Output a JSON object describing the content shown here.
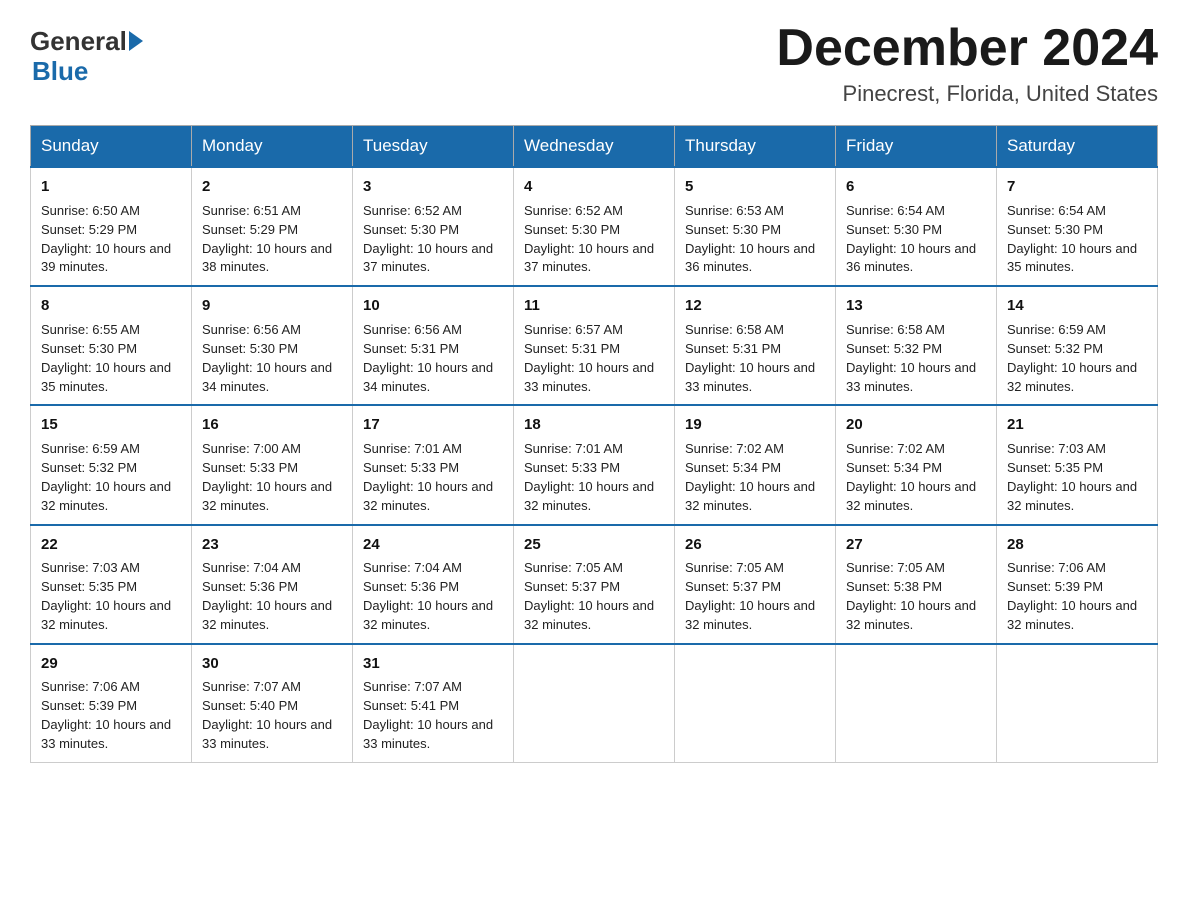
{
  "header": {
    "logo_general": "General",
    "logo_blue": "Blue",
    "month_title": "December 2024",
    "location": "Pinecrest, Florida, United States"
  },
  "weekdays": [
    "Sunday",
    "Monday",
    "Tuesday",
    "Wednesday",
    "Thursday",
    "Friday",
    "Saturday"
  ],
  "weeks": [
    [
      {
        "day": "1",
        "sunrise": "6:50 AM",
        "sunset": "5:29 PM",
        "daylight": "10 hours and 39 minutes."
      },
      {
        "day": "2",
        "sunrise": "6:51 AM",
        "sunset": "5:29 PM",
        "daylight": "10 hours and 38 minutes."
      },
      {
        "day": "3",
        "sunrise": "6:52 AM",
        "sunset": "5:30 PM",
        "daylight": "10 hours and 37 minutes."
      },
      {
        "day": "4",
        "sunrise": "6:52 AM",
        "sunset": "5:30 PM",
        "daylight": "10 hours and 37 minutes."
      },
      {
        "day": "5",
        "sunrise": "6:53 AM",
        "sunset": "5:30 PM",
        "daylight": "10 hours and 36 minutes."
      },
      {
        "day": "6",
        "sunrise": "6:54 AM",
        "sunset": "5:30 PM",
        "daylight": "10 hours and 36 minutes."
      },
      {
        "day": "7",
        "sunrise": "6:54 AM",
        "sunset": "5:30 PM",
        "daylight": "10 hours and 35 minutes."
      }
    ],
    [
      {
        "day": "8",
        "sunrise": "6:55 AM",
        "sunset": "5:30 PM",
        "daylight": "10 hours and 35 minutes."
      },
      {
        "day": "9",
        "sunrise": "6:56 AM",
        "sunset": "5:30 PM",
        "daylight": "10 hours and 34 minutes."
      },
      {
        "day": "10",
        "sunrise": "6:56 AM",
        "sunset": "5:31 PM",
        "daylight": "10 hours and 34 minutes."
      },
      {
        "day": "11",
        "sunrise": "6:57 AM",
        "sunset": "5:31 PM",
        "daylight": "10 hours and 33 minutes."
      },
      {
        "day": "12",
        "sunrise": "6:58 AM",
        "sunset": "5:31 PM",
        "daylight": "10 hours and 33 minutes."
      },
      {
        "day": "13",
        "sunrise": "6:58 AM",
        "sunset": "5:32 PM",
        "daylight": "10 hours and 33 minutes."
      },
      {
        "day": "14",
        "sunrise": "6:59 AM",
        "sunset": "5:32 PM",
        "daylight": "10 hours and 32 minutes."
      }
    ],
    [
      {
        "day": "15",
        "sunrise": "6:59 AM",
        "sunset": "5:32 PM",
        "daylight": "10 hours and 32 minutes."
      },
      {
        "day": "16",
        "sunrise": "7:00 AM",
        "sunset": "5:33 PM",
        "daylight": "10 hours and 32 minutes."
      },
      {
        "day": "17",
        "sunrise": "7:01 AM",
        "sunset": "5:33 PM",
        "daylight": "10 hours and 32 minutes."
      },
      {
        "day": "18",
        "sunrise": "7:01 AM",
        "sunset": "5:33 PM",
        "daylight": "10 hours and 32 minutes."
      },
      {
        "day": "19",
        "sunrise": "7:02 AM",
        "sunset": "5:34 PM",
        "daylight": "10 hours and 32 minutes."
      },
      {
        "day": "20",
        "sunrise": "7:02 AM",
        "sunset": "5:34 PM",
        "daylight": "10 hours and 32 minutes."
      },
      {
        "day": "21",
        "sunrise": "7:03 AM",
        "sunset": "5:35 PM",
        "daylight": "10 hours and 32 minutes."
      }
    ],
    [
      {
        "day": "22",
        "sunrise": "7:03 AM",
        "sunset": "5:35 PM",
        "daylight": "10 hours and 32 minutes."
      },
      {
        "day": "23",
        "sunrise": "7:04 AM",
        "sunset": "5:36 PM",
        "daylight": "10 hours and 32 minutes."
      },
      {
        "day": "24",
        "sunrise": "7:04 AM",
        "sunset": "5:36 PM",
        "daylight": "10 hours and 32 minutes."
      },
      {
        "day": "25",
        "sunrise": "7:05 AM",
        "sunset": "5:37 PM",
        "daylight": "10 hours and 32 minutes."
      },
      {
        "day": "26",
        "sunrise": "7:05 AM",
        "sunset": "5:37 PM",
        "daylight": "10 hours and 32 minutes."
      },
      {
        "day": "27",
        "sunrise": "7:05 AM",
        "sunset": "5:38 PM",
        "daylight": "10 hours and 32 minutes."
      },
      {
        "day": "28",
        "sunrise": "7:06 AM",
        "sunset": "5:39 PM",
        "daylight": "10 hours and 32 minutes."
      }
    ],
    [
      {
        "day": "29",
        "sunrise": "7:06 AM",
        "sunset": "5:39 PM",
        "daylight": "10 hours and 33 minutes."
      },
      {
        "day": "30",
        "sunrise": "7:07 AM",
        "sunset": "5:40 PM",
        "daylight": "10 hours and 33 minutes."
      },
      {
        "day": "31",
        "sunrise": "7:07 AM",
        "sunset": "5:41 PM",
        "daylight": "10 hours and 33 minutes."
      },
      null,
      null,
      null,
      null
    ]
  ]
}
